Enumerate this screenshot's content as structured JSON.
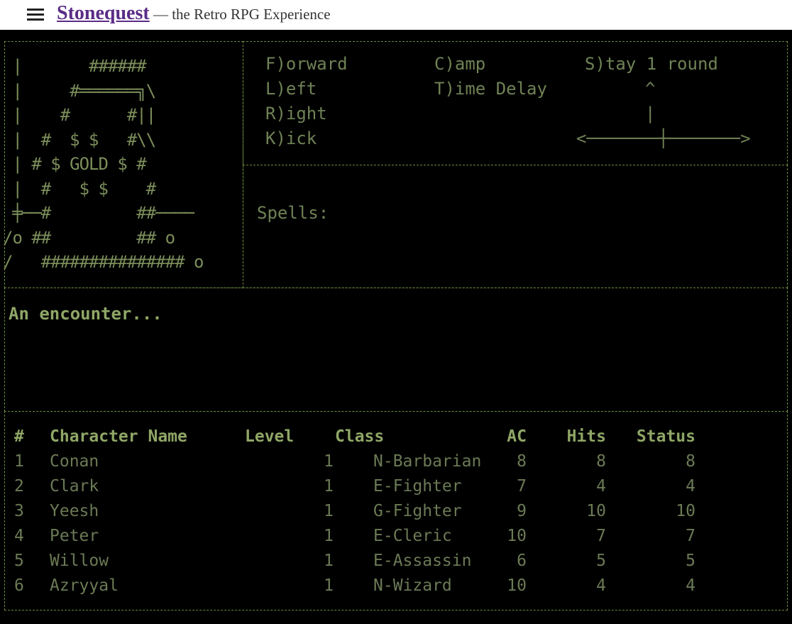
{
  "header": {
    "menu_icon": "hamburger-menu-icon",
    "brand": "Stonequest",
    "tagline": " — the Retro RPG Experience"
  },
  "map_art": [
    " |       ######",
    " |     #══════╗\\",
    " |    #      #||",
    " |  #  $ $   #\\\\",
    " | # $ GOLD $ #",
    " |  #   $ $    #",
    " ╪──#         ##────",
    "/o ##         ## o",
    "/   ############### o"
  ],
  "commands": {
    "forward": "F)orward",
    "left": "L)eft",
    "right": "R)ight",
    "kick": "K)ick",
    "camp": "C)amp",
    "time_delay": "T)ime Delay",
    "stay": "S)tay 1 round",
    "arrow_up": "^",
    "arrow_mid": "|",
    "arrow_row": "<───────┼───────>"
  },
  "spells_label": "Spells:",
  "encounter_text": "An encounter...",
  "roster": {
    "headers": [
      "#",
      "Character Name",
      "Level",
      "Class",
      "AC",
      "Hits",
      "Status"
    ],
    "rows": [
      [
        "1",
        "Conan",
        "1",
        "N-Barbarian",
        "8",
        "8",
        "8"
      ],
      [
        "2",
        "Clark",
        "1",
        "E-Fighter",
        "7",
        "4",
        "4"
      ],
      [
        "3",
        "Yeesh",
        "1",
        "G-Fighter",
        "9",
        "10",
        "10"
      ],
      [
        "4",
        "Peter",
        "1",
        "E-Cleric",
        "10",
        "7",
        "7"
      ],
      [
        "5",
        "Willow",
        "1",
        "E-Assassin",
        "6",
        "5",
        "5"
      ],
      [
        "6",
        "Azryyal",
        "1",
        "N-Wizard",
        "10",
        "4",
        "4"
      ]
    ]
  },
  "colors": {
    "terminal_bg": "#000000",
    "terminal_text": "#7b8e5a",
    "brand": "#5b2c87"
  }
}
